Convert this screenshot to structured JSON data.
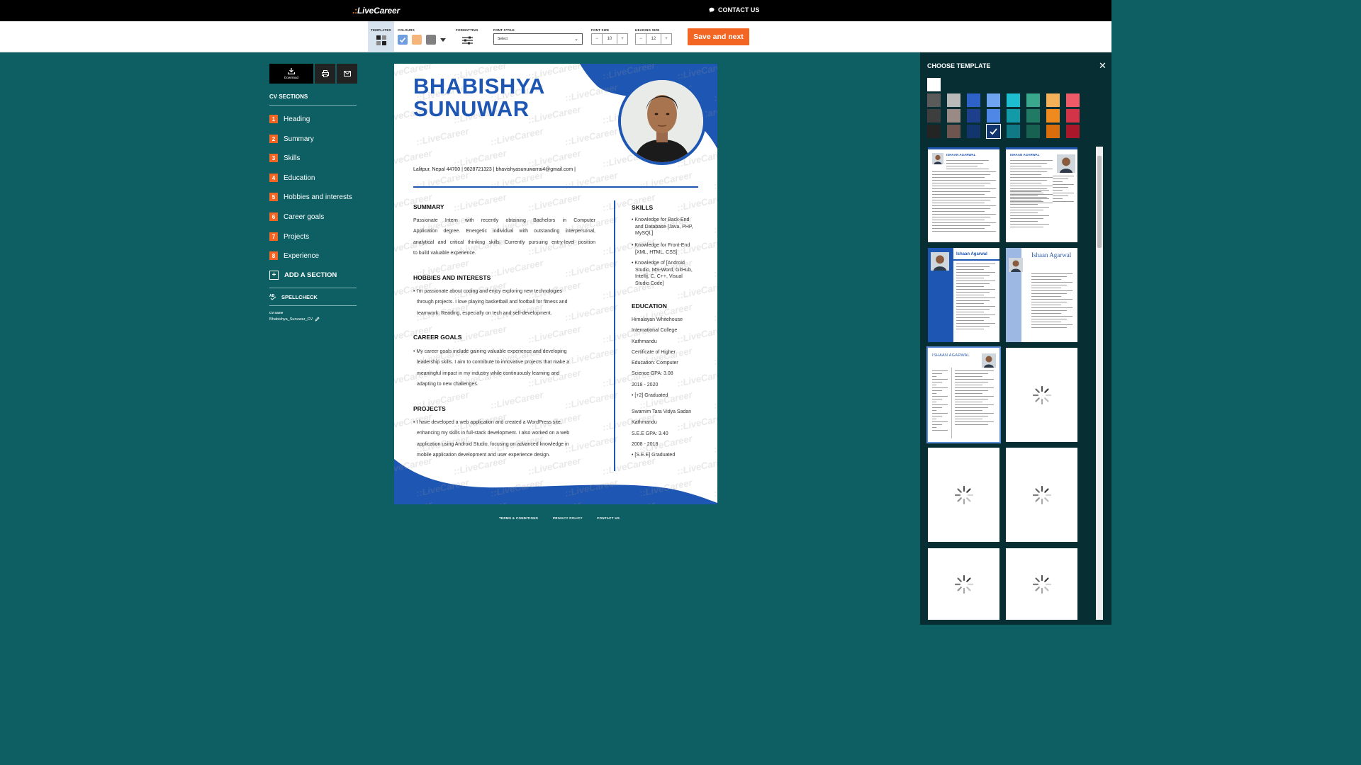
{
  "topbar": {
    "brand_dots": ".:",
    "brand": "LiveCareer",
    "contact": "CONTACT US"
  },
  "toolbar": {
    "templates_label": "TEMPLATES",
    "colours_label": "COLOURS",
    "formatting_label": "FORMATTING",
    "font_style_label": "FONT STYLE",
    "font_style_value": "Select",
    "font_size_label": "FONT SIZE",
    "font_size_value": "10",
    "heading_size_label": "HEADING SIZE",
    "heading_size_value": "12",
    "minus": "−",
    "plus": "+",
    "save_next": "Save and next",
    "colours": [
      "#6f9ee0",
      "#f5b57a",
      "#808080"
    ]
  },
  "left": {
    "download": "Download",
    "cv_sections_title": "CV SECTIONS",
    "sections": [
      {
        "num": "1",
        "label": "Heading"
      },
      {
        "num": "2",
        "label": "Summary"
      },
      {
        "num": "3",
        "label": "Skills"
      },
      {
        "num": "4",
        "label": "Education"
      },
      {
        "num": "5",
        "label": "Hobbies and interests"
      },
      {
        "num": "6",
        "label": "Career goals"
      },
      {
        "num": "7",
        "label": "Projects"
      },
      {
        "num": "8",
        "label": "Experience"
      }
    ],
    "add_section": "ADD A SECTION",
    "spellcheck": "SPELLCHECK",
    "cv_name_label": "CV name",
    "cv_name_value": "Bhabishya_Sunuwar_CV"
  },
  "resume": {
    "name_line1": "BHABISHYA",
    "name_line2": "SUNUWAR",
    "contact": "Lalitpur, Nepal 44700 | 9828721323 | bhavishyasunuwarrai4@gmail.com |",
    "watermark": "::LiveCareer",
    "summary_title": "SUMMARY",
    "summary_lines": [
      "Passionate Intern with recently obtaining Bachelors in Computer",
      "Application degree. Energetic individual with outstanding interpersonal,",
      "analytical and critical thinking skills. Currently pursuing entry-level position",
      "to build valuable experience."
    ],
    "hobbies_title": "HOBBIES AND INTERESTS",
    "hobbies_lines": [
      "• I'm passionate about coding and enjoy exploring new technologies",
      "through projects. I love playing basketball and football for fitness and",
      "teamwork. Reading, especially on tech and self-development."
    ],
    "career_title": "CAREER GOALS",
    "career_lines": [
      "• My career goals include gaining valuable experience and developing",
      "leadership skills. I aim to contribute to innovative projects that make a",
      "meaningful impact in my industry while continuously learning and",
      "adapting to new challenges."
    ],
    "projects_title": "PROJECTS",
    "projects_lines": [
      "• I have developed a web application and created a WordPress site,",
      "enhancing my skills in full-stack development. I also worked on a web",
      "application using Android Studio, focusing on advanced knowledge in",
      "mobile application development and user experience design."
    ],
    "skills_title": "SKILLS",
    "skills": [
      [
        "• Knowledge for Back-End",
        "and Database [Java, PHP,",
        "MySQL]"
      ],
      [
        "• Knowledge for Front-End",
        "[XML, HTML, CSS]"
      ],
      [
        "• Knowledge of [Android",
        "Studio, MS-Word, GitHub,",
        "Intellij, C, C++, Visual",
        "Studio Code]"
      ]
    ],
    "education_title": "EDUCATION",
    "education_lines_1": [
      "Himalayan Whitehouse",
      "International College",
      "Kathmandu",
      "Certificate of Higher",
      "Education: Computer",
      "Science GPA: 3.08",
      "2018 - 2020",
      "• [+2] Graduated"
    ],
    "education_lines_2": [
      "Swarnim Tara Vidya Sadan",
      "Kathmandu",
      "S.E.E GPA: 3.40",
      "2008 - 2018",
      "• [S.E.E] Graduated"
    ]
  },
  "footer": {
    "terms": "TERMS & CONDITIONS",
    "privacy": "PRIVACY POLICY",
    "contact": "CONTACT US"
  },
  "right_panel": {
    "title": "CHOOSE TEMPLATE",
    "close": "✕",
    "selected_color": "#12356e",
    "palette_top": "#ffffff",
    "palette": [
      [
        "#5a5a5a",
        "#b9b9b9",
        "#2f62c8",
        "#6fa5f0",
        "#1dbed0",
        "#3aa88c",
        "#f5b159",
        "#ee5a67"
      ],
      [
        "#3e3e3e",
        "#9a8a85",
        "#1d3f8c",
        "#4e87e6",
        "#129aa8",
        "#217a63",
        "#ee8a1e",
        "#d43447"
      ],
      [
        "#242424",
        "#6e5650",
        "#12356e",
        "#12356e",
        "#0f7a86",
        "#16614f",
        "#d96d0b",
        "#a8182a"
      ]
    ],
    "thumb_names": [
      "ISHAAN AGARWAL",
      "ISHAAN AGARWAL",
      "Ishaan Agarwal",
      "Ishaan Agarwal",
      "ISHAAN AGARWAL"
    ]
  }
}
